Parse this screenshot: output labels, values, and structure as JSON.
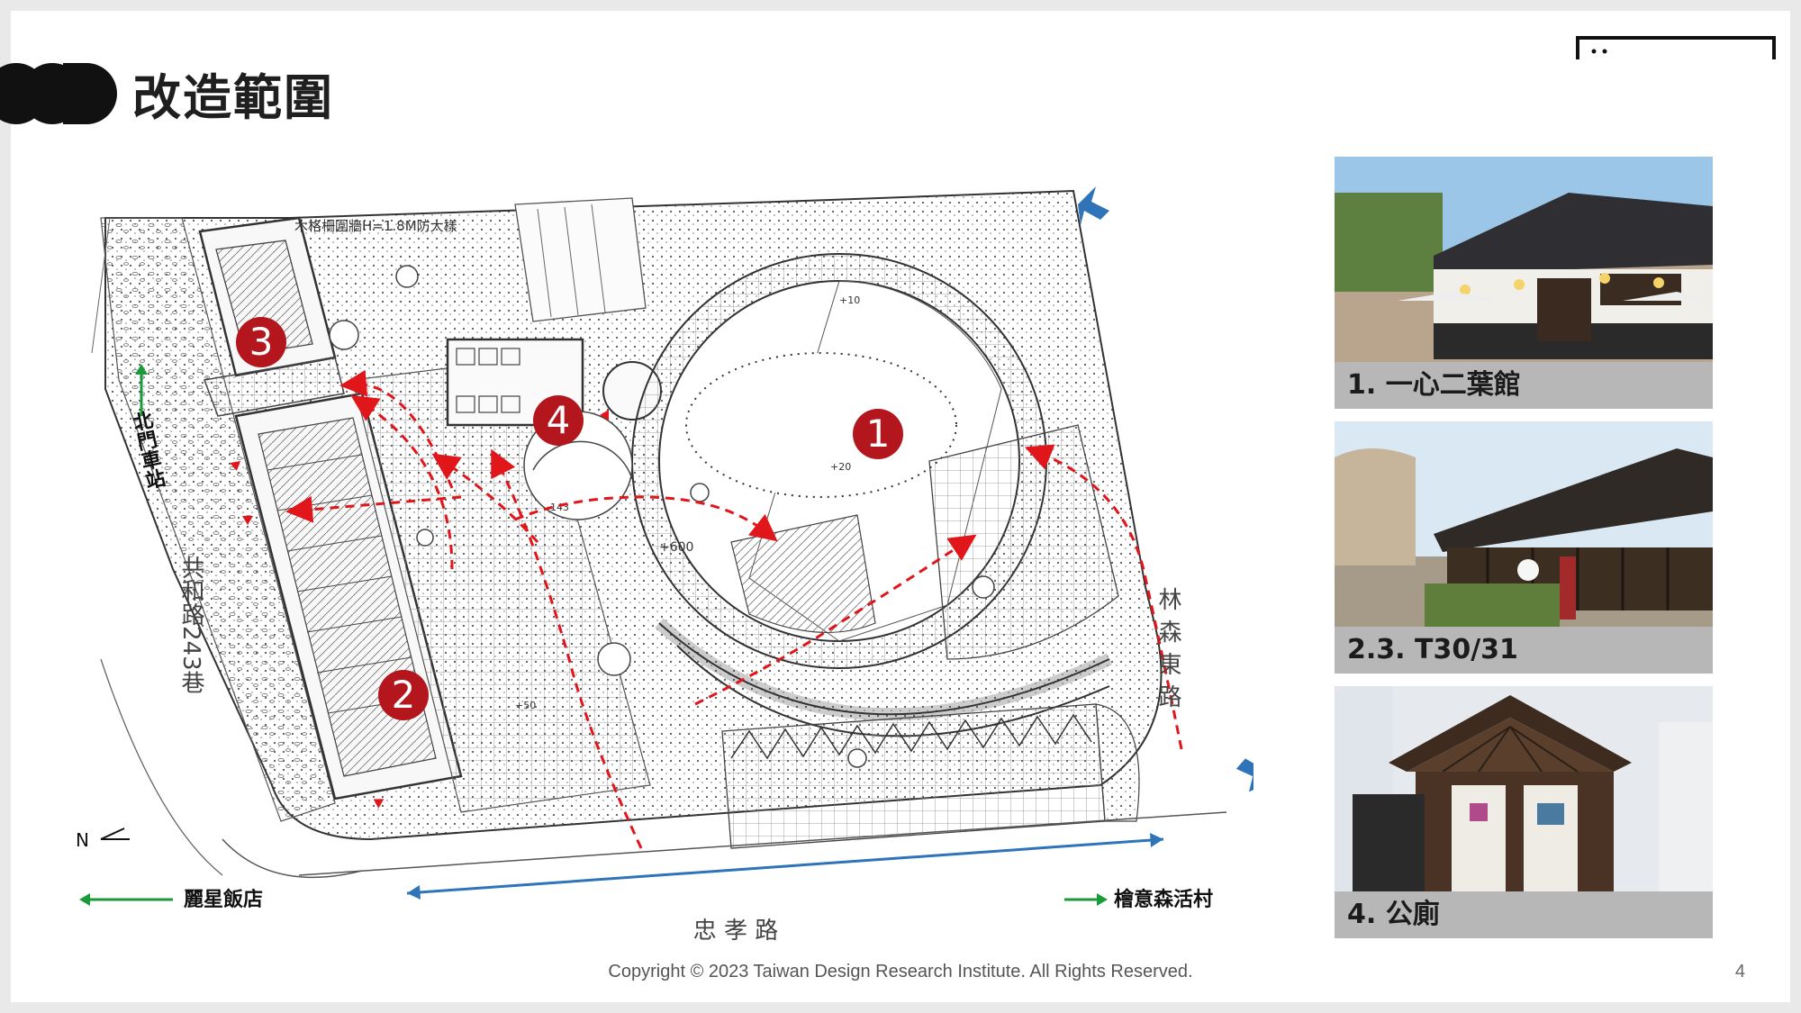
{
  "header": {
    "title": "改造範圍"
  },
  "plan": {
    "markers": [
      "1",
      "2",
      "3",
      "4"
    ],
    "plan_notes": {
      "wood_fence": "木格柵圍牆H=1.8M防大樣",
      "elev_20": "+20",
      "elev_600": "+600",
      "elev_neg143": "-143",
      "elev_50": "+50",
      "elev_10": "+10"
    },
    "streets": {
      "west_lane": "共和路243巷",
      "east_road": "林森東路",
      "south_road": "忠 孝 路"
    },
    "directions": {
      "north_station": "北門車站",
      "hotel": "麗星飯店",
      "village": "檜意森活村",
      "north": "N"
    }
  },
  "photos": [
    {
      "caption": "1. 一心二葉館"
    },
    {
      "caption": "2.3. T30/31"
    },
    {
      "caption": "4. 公廁"
    }
  ],
  "footer": {
    "copyright": "Copyright © 2023 Taiwan Design Research Institute. All Rights Reserved.",
    "page_number": "4"
  },
  "colors": {
    "marker_red": "#b3171d",
    "route_red": "#e0161b",
    "arrow_blue": "#2f73b8",
    "arrow_green": "#1a9a3a",
    "caption_bg": "#b7b7b7"
  }
}
